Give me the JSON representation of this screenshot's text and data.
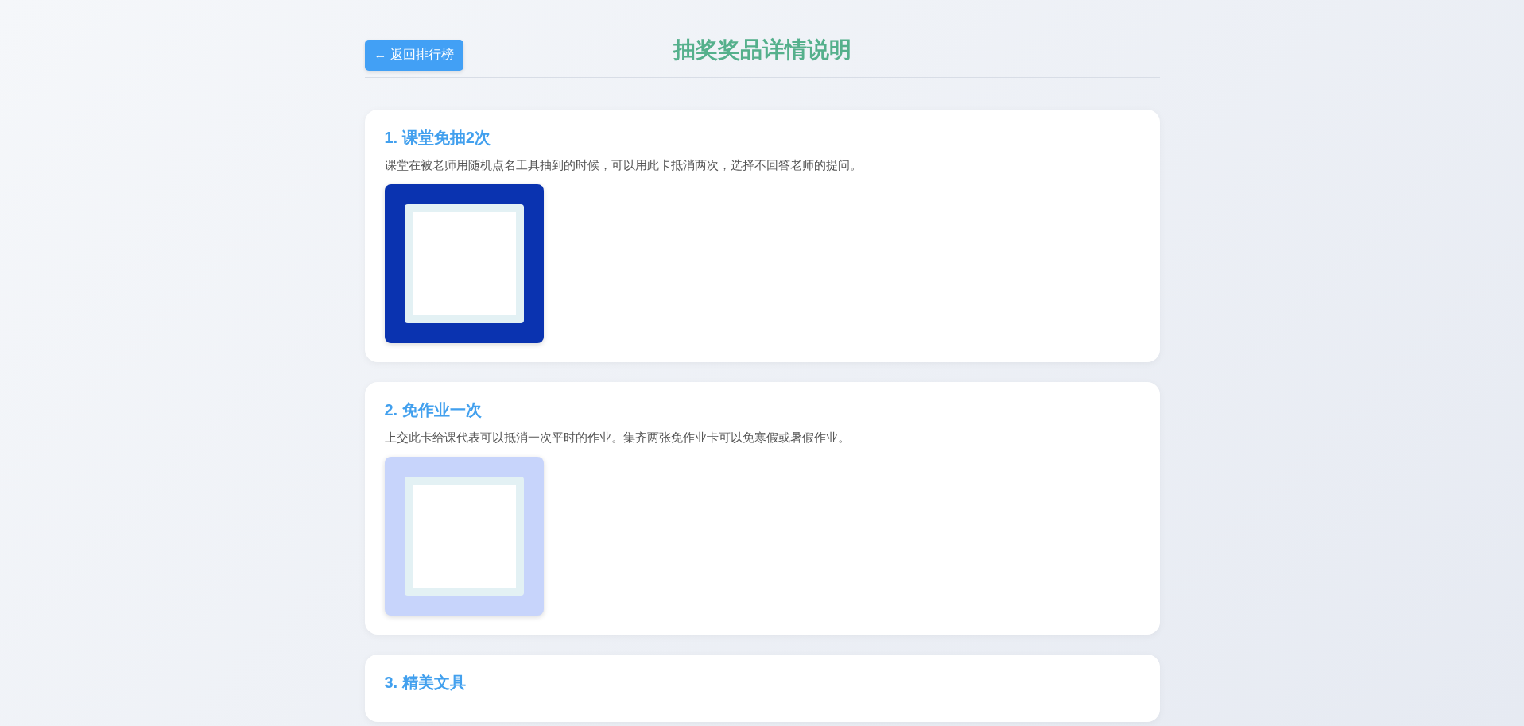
{
  "back_button": {
    "label": "← 返回排行榜"
  },
  "page_title": "抽奖奖品详情说明",
  "prizes": [
    {
      "title": "1. 课堂免抽2次",
      "description": "课堂在被老师用随机点名工具抽到的时候，可以用此卡抵消两次，选择不回答老师的提问。",
      "image": {
        "color": "#0a33b0"
      }
    },
    {
      "title": "2. 免作业一次",
      "description": "上交此卡给课代表可以抵消一次平时的作业。集齐两张免作业卡可以免寒假或暑假作业。",
      "image": {
        "color": "#c7d4fb"
      }
    },
    {
      "title": "3. 精美文具"
    }
  ]
}
